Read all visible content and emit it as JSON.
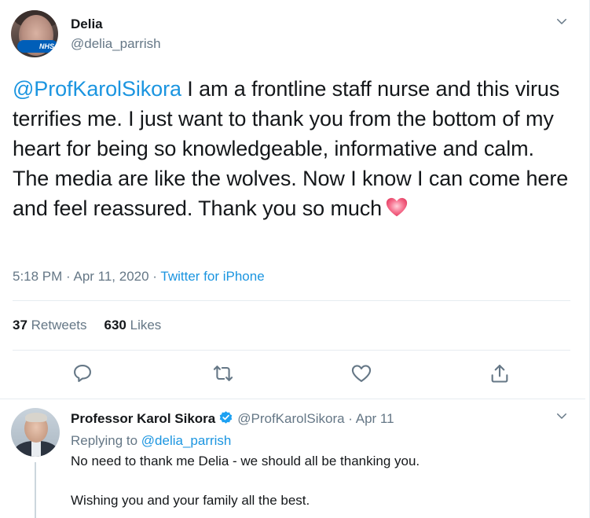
{
  "main_tweet": {
    "author_name": "Delia",
    "author_handle": "@delia_parrish",
    "avatar_badge": "NHS",
    "text_mention": "@ProfKarolSikora",
    "text_body": " I am a frontline staff nurse and this virus terrifies me. I just want to thank you from the bottom of my heart for being so knowledgeable, informative and calm. The media are like the wolves. Now I know I can come here and feel reassured. Thank you so much",
    "emoji": "heart-emoji",
    "time": "5:18 PM",
    "separator": " · ",
    "date": "Apr 11, 2020",
    "source": "Twitter for iPhone",
    "retweets_count": "37",
    "retweets_label": " Retweets",
    "likes_count": "630",
    "likes_label": " Likes",
    "actions": [
      "reply-icon",
      "retweet-icon",
      "like-icon",
      "share-icon"
    ]
  },
  "reply_tweet": {
    "author_name": "Professor Karol Sikora",
    "verified": true,
    "author_handle": "@ProfKarolSikora",
    "separator": " · ",
    "date": "Apr 11",
    "replying_prefix": "Replying to ",
    "replying_to": "@delia_parrish",
    "line1": "No need to thank me Delia - we should all be thanking you.",
    "line2": "Wishing you and your family all the best."
  },
  "colors": {
    "text": "#14171a",
    "secondary": "#657786",
    "link": "#1b95e0",
    "divider": "#e6ecf0",
    "nhs_blue": "#005eb8"
  }
}
